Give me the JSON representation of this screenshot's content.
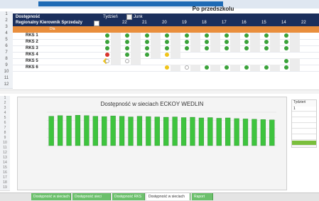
{
  "sheet": {
    "title": "Po przedszkolu",
    "band_label_a": "Dostępność",
    "band_label_b": "Regionalny Kierownik Sprzedaży",
    "filter_label": "Tydzień",
    "filter_value": "Junk",
    "header_numbers": [
      "22",
      "21",
      "20",
      "19",
      "18",
      "17",
      "16",
      "15",
      "14",
      "22"
    ],
    "orange_headers": [
      "Dla",
      "",
      ""
    ],
    "row_numbers": [
      "1",
      "2",
      "3",
      "4",
      "5",
      "6",
      "7",
      "8",
      "9",
      "10",
      "11",
      "12",
      "13",
      "14",
      "15",
      "16",
      "17"
    ],
    "rows": [
      {
        "label": "RKS 1"
      },
      {
        "label": "RKS 2"
      },
      {
        "label": "RKS 3"
      },
      {
        "label": "RKS 4"
      },
      {
        "label": "RKS 5"
      },
      {
        "label": "RKS 6"
      }
    ],
    "status_colors": {
      "green": "#3aa33a",
      "yellow": "#f0c419",
      "red": "#d9342b"
    }
  },
  "chart_data": {
    "type": "bar",
    "title": "Dostępność w sieciach ECKOY WEDLIN",
    "categories": [
      "",
      "",
      "",
      "",
      "",
      "",
      "",
      "",
      "",
      "",
      "",
      "",
      "",
      "",
      "",
      "",
      "",
      "",
      "",
      "",
      "",
      "",
      "",
      "",
      "",
      ""
    ],
    "values": [
      88,
      90,
      89,
      91,
      90,
      88,
      87,
      89,
      88,
      86,
      88,
      87,
      86,
      85,
      86,
      84,
      85,
      83,
      84,
      82,
      83,
      81,
      80,
      79,
      78,
      77
    ],
    "ylim": [
      0,
      100
    ],
    "grid": true,
    "bar_color": "#3ec43e"
  },
  "side_panel": {
    "title": "Tydzień",
    "items": [
      "1",
      "",
      "",
      "",
      "",
      "",
      ""
    ]
  },
  "tabs": [
    {
      "label": "Dostępność w sieciach"
    },
    {
      "label": "Dostępność sieci"
    },
    {
      "label": "Dostępność RKS"
    },
    {
      "label": "Dostępność w sieciach"
    },
    {
      "label": "Raport"
    }
  ]
}
